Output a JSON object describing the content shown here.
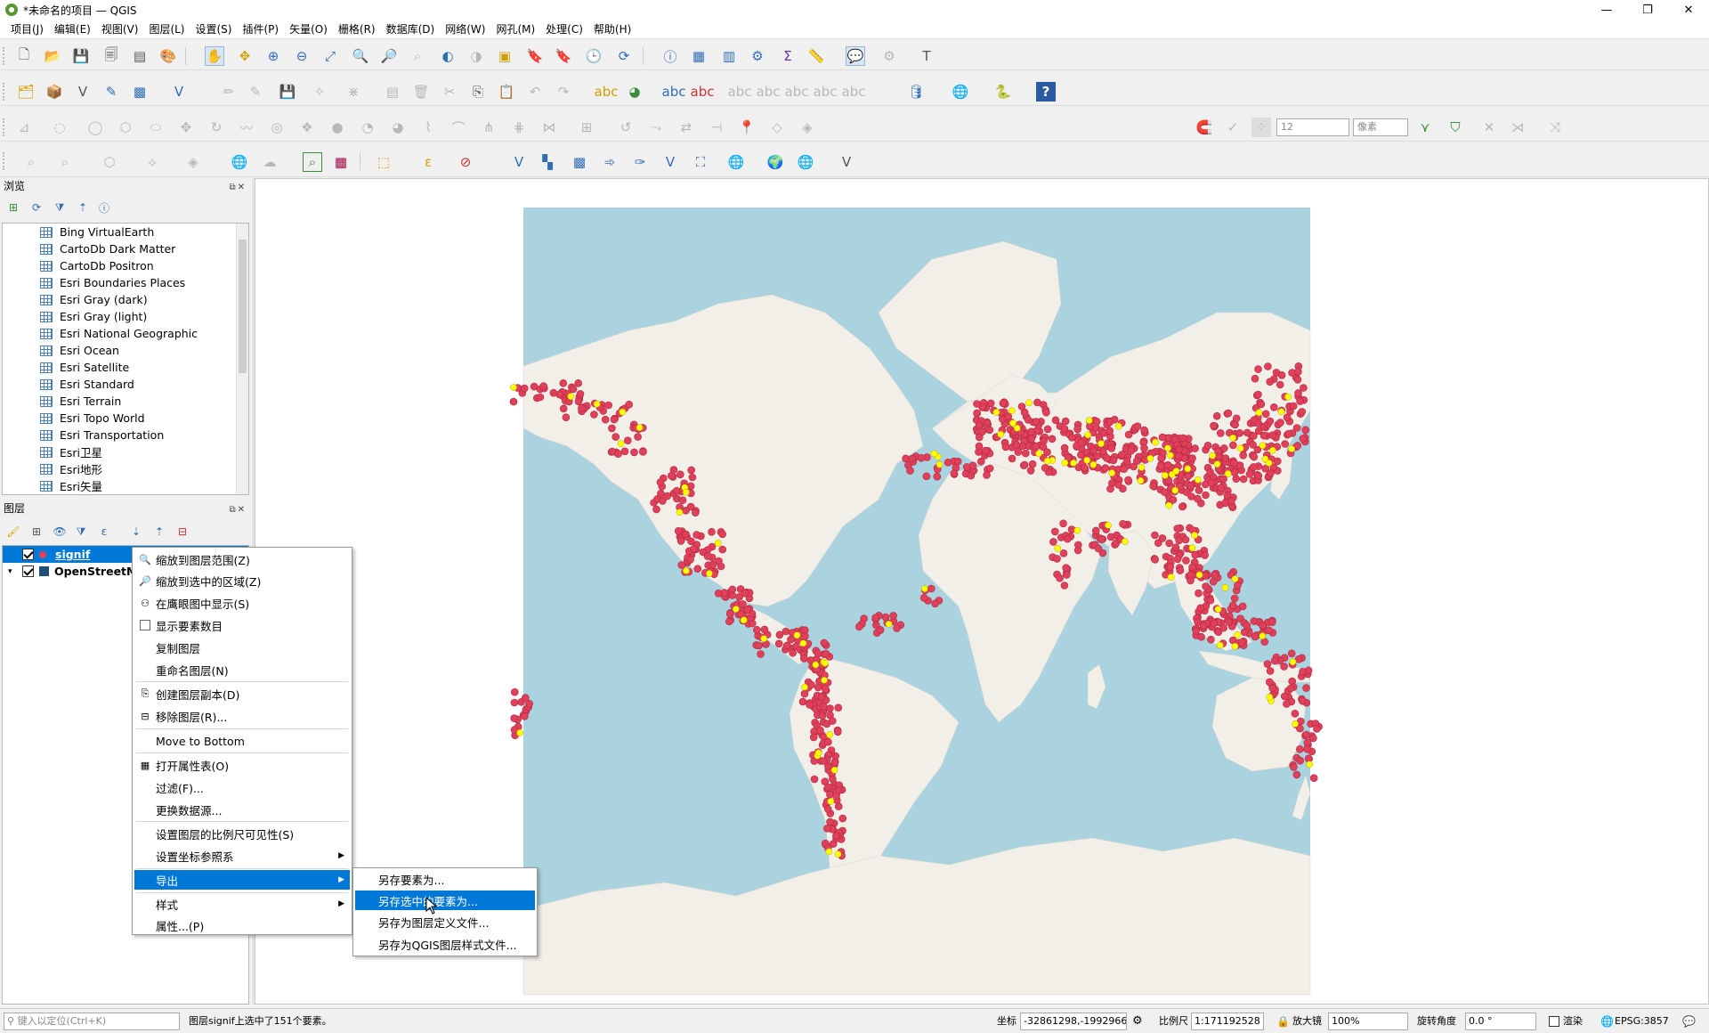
{
  "window": {
    "title": "*未命名的项目 — QGIS",
    "minimize": "—",
    "maximize": "❐",
    "close": "✕"
  },
  "menubar": [
    {
      "label": "项目(J)"
    },
    {
      "label": "编辑(E)"
    },
    {
      "label": "视图(V)"
    },
    {
      "label": "图层(L)"
    },
    {
      "label": "设置(S)"
    },
    {
      "label": "插件(P)"
    },
    {
      "label": "矢量(O)"
    },
    {
      "label": "栅格(R)"
    },
    {
      "label": "数据库(D)"
    },
    {
      "label": "网络(W)"
    },
    {
      "label": "网孔(M)"
    },
    {
      "label": "处理(C)"
    },
    {
      "label": "帮助(H)"
    }
  ],
  "snapping": {
    "tolerance": "12",
    "unit": "像素"
  },
  "browser_panel": {
    "title": "浏览",
    "items": [
      "Bing VirtualEarth",
      "CartoDb Dark Matter",
      "CartoDb Positron",
      "Esri Boundaries Places",
      "Esri Gray (dark)",
      "Esri Gray (light)",
      "Esri National Geographic",
      "Esri Ocean",
      "Esri Satellite",
      "Esri Standard",
      "Esri Terrain",
      "Esri Topo World",
      "Esri Transportation",
      "Esri卫星",
      "Esri地形",
      "Esri矢量"
    ]
  },
  "layers_panel": {
    "title": "图层",
    "layers": [
      {
        "name": "signif",
        "checked": true,
        "selected": true
      },
      {
        "name": "OpenStreetM",
        "checked": true,
        "selected": false
      }
    ]
  },
  "context_menu": {
    "items": [
      {
        "label": "缩放到图层范围(Z)",
        "icon": "zoom-layer-icon"
      },
      {
        "label": "缩放到选中的区域(Z)",
        "icon": "zoom-selection-icon"
      },
      {
        "label": "在鹰眼图中显示(S)",
        "icon": "overview-icon"
      },
      {
        "label": "显示要素数目",
        "icon": "checkbox-icon"
      },
      {
        "label": "复制图层",
        "icon": ""
      },
      {
        "label": "重命名图层(N)",
        "icon": ""
      },
      {
        "label": "创建图层副本(D)",
        "icon": "duplicate-icon"
      },
      {
        "label": "移除图层(R)...",
        "icon": "remove-icon"
      },
      {
        "label": "Move to Bottom",
        "icon": ""
      },
      {
        "label": "打开属性表(O)",
        "icon": "table-icon"
      },
      {
        "label": "过滤(F)...",
        "icon": ""
      },
      {
        "label": "更换数据源...",
        "icon": ""
      },
      {
        "label": "设置图层的比例尺可见性(S)",
        "icon": ""
      },
      {
        "label": "设置坐标参照系",
        "icon": ""
      },
      {
        "label": "导出",
        "icon": ""
      },
      {
        "label": "样式",
        "icon": ""
      },
      {
        "label": "属性...(P)",
        "icon": ""
      }
    ]
  },
  "export_submenu": {
    "items": [
      {
        "label": "另存要素为..."
      },
      {
        "label": "另存选中的要素为..."
      },
      {
        "label": "另存为图层定义文件..."
      },
      {
        "label": "另存为QGIS图层样式文件..."
      }
    ]
  },
  "statusbar": {
    "locator_placeholder": "键入以定位(Ctrl+K)",
    "message": "图层signif上选中了151个要素。",
    "coord_label": "坐标",
    "coord_value": "-32861298,-1992966",
    "scale_label": "比例尺",
    "scale_value": "1:171192528",
    "magnifier_label": "放大镜",
    "magnifier_value": "100%",
    "rotation_label": "旋转角度",
    "rotation_value": "0.0 °",
    "render_label": "渲染",
    "crs": "EPSG:3857"
  },
  "colors": {
    "ocean": "#aad3df",
    "land": "#f2efe9",
    "point": "#e0405a",
    "selected_point": "#ffff00",
    "accent": "#0078d7"
  }
}
